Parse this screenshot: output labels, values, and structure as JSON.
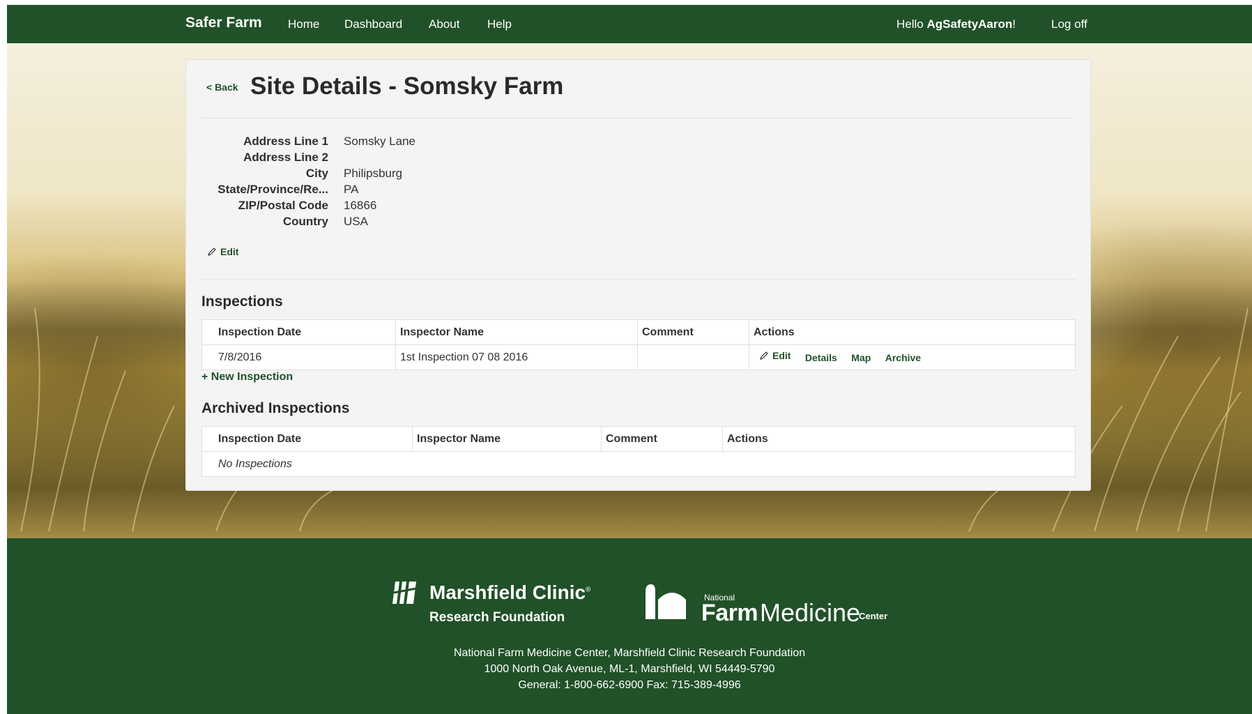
{
  "nav": {
    "brand": "Safer Farm",
    "links": [
      "Home",
      "Dashboard",
      "About",
      "Help"
    ],
    "hello_prefix": "Hello ",
    "username": "AgSafetyAaron",
    "hello_suffix": "!",
    "logoff": "Log off"
  },
  "page": {
    "back": "< Back",
    "title": "Site Details - Somsky Farm"
  },
  "address": [
    {
      "label": "Address Line 1",
      "value": "Somsky Lane"
    },
    {
      "label": "Address Line 2",
      "value": ""
    },
    {
      "label": "City",
      "value": "Philipsburg"
    },
    {
      "label": "State/Province/Re...",
      "value": "PA"
    },
    {
      "label": "ZIP/Postal Code",
      "value": "16866"
    },
    {
      "label": "Country",
      "value": "USA"
    }
  ],
  "edit_label": "Edit",
  "inspections": {
    "title": "Inspections",
    "headers": [
      "Inspection Date",
      "Inspector Name",
      "Comment",
      "Actions"
    ],
    "rows": [
      {
        "date": "7/8/2016",
        "inspector": "1st Inspection 07 08 2016",
        "comment": "",
        "actions": [
          "Edit",
          "Details",
          "Map",
          "Archive"
        ]
      }
    ],
    "new_link": "+ New Inspection"
  },
  "archived": {
    "title": "Archived Inspections",
    "headers": [
      "Inspection Date",
      "Inspector Name",
      "Comment",
      "Actions"
    ],
    "empty": "No Inspections"
  },
  "footer": {
    "mc_name": "Marshfield Clinic",
    "mc_reg": "®",
    "mc_sub": "Research Foundation",
    "nfm_national": "National",
    "nfm_farm": "Farm",
    "nfm_medicine": "Medicine",
    "nfm_center": "Center",
    "lines": [
      "National Farm Medicine Center, Marshfield Clinic Research Foundation",
      "1000 North Oak Avenue, ML-1, Marshfield, WI 54449-5790",
      "General: 1-800-662-6900 Fax: 715-389-4996"
    ]
  },
  "colors": {
    "brand_green": "#215128",
    "panel_bg": "#f4f4f4"
  }
}
